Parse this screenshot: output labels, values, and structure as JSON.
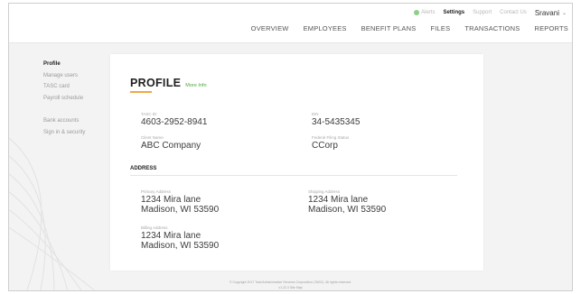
{
  "header": {
    "alerts_label": "Alerts",
    "settings_label": "Settings",
    "support_label": "Support",
    "contact_label": "Contact Us",
    "user_name": "Sravani",
    "nav": [
      "OVERVIEW",
      "EMPLOYEES",
      "BENEFIT PLANS",
      "FILES",
      "TRANSACTIONS",
      "REPORTS"
    ]
  },
  "sidebar": {
    "items": [
      "Profile",
      "Manage users",
      "TASC card",
      "Payroll schedule",
      "Bank accounts",
      "Sign in & security"
    ]
  },
  "profile": {
    "title": "PROFILE",
    "more_info": "More Info",
    "tasc_id_label": "TASC ID",
    "tasc_id": "4603-2952-8941",
    "ein_label": "EIN",
    "ein": "34-5435345",
    "client_name_label": "Client Name",
    "client_name": "ABC Company",
    "filing_status_label": "Federal Filing Status",
    "filing_status": "CCorp"
  },
  "address": {
    "section_title": "ADDRESS",
    "primary_label": "Primary Address",
    "primary_line1": "1234 Mira lane",
    "primary_line2": "Madison,  WI 53590",
    "shipping_label": "Shipping Address",
    "shipping_line1": "1234 Mira lane",
    "shipping_line2": "Madison,  WI 53590",
    "billing_label": "Billing Address",
    "billing_line1": "1234 Mira lane",
    "billing_line2": "Madison,  WI 53590"
  },
  "footer": {
    "copyright": "© Copyright 2017 Total Administrative Services Corporation (TASC). All rights reserved.",
    "links": "v1.22.3  Site Map"
  },
  "colors": {
    "accent_orange": "#f0a64a",
    "link_green": "#4ea83a"
  }
}
